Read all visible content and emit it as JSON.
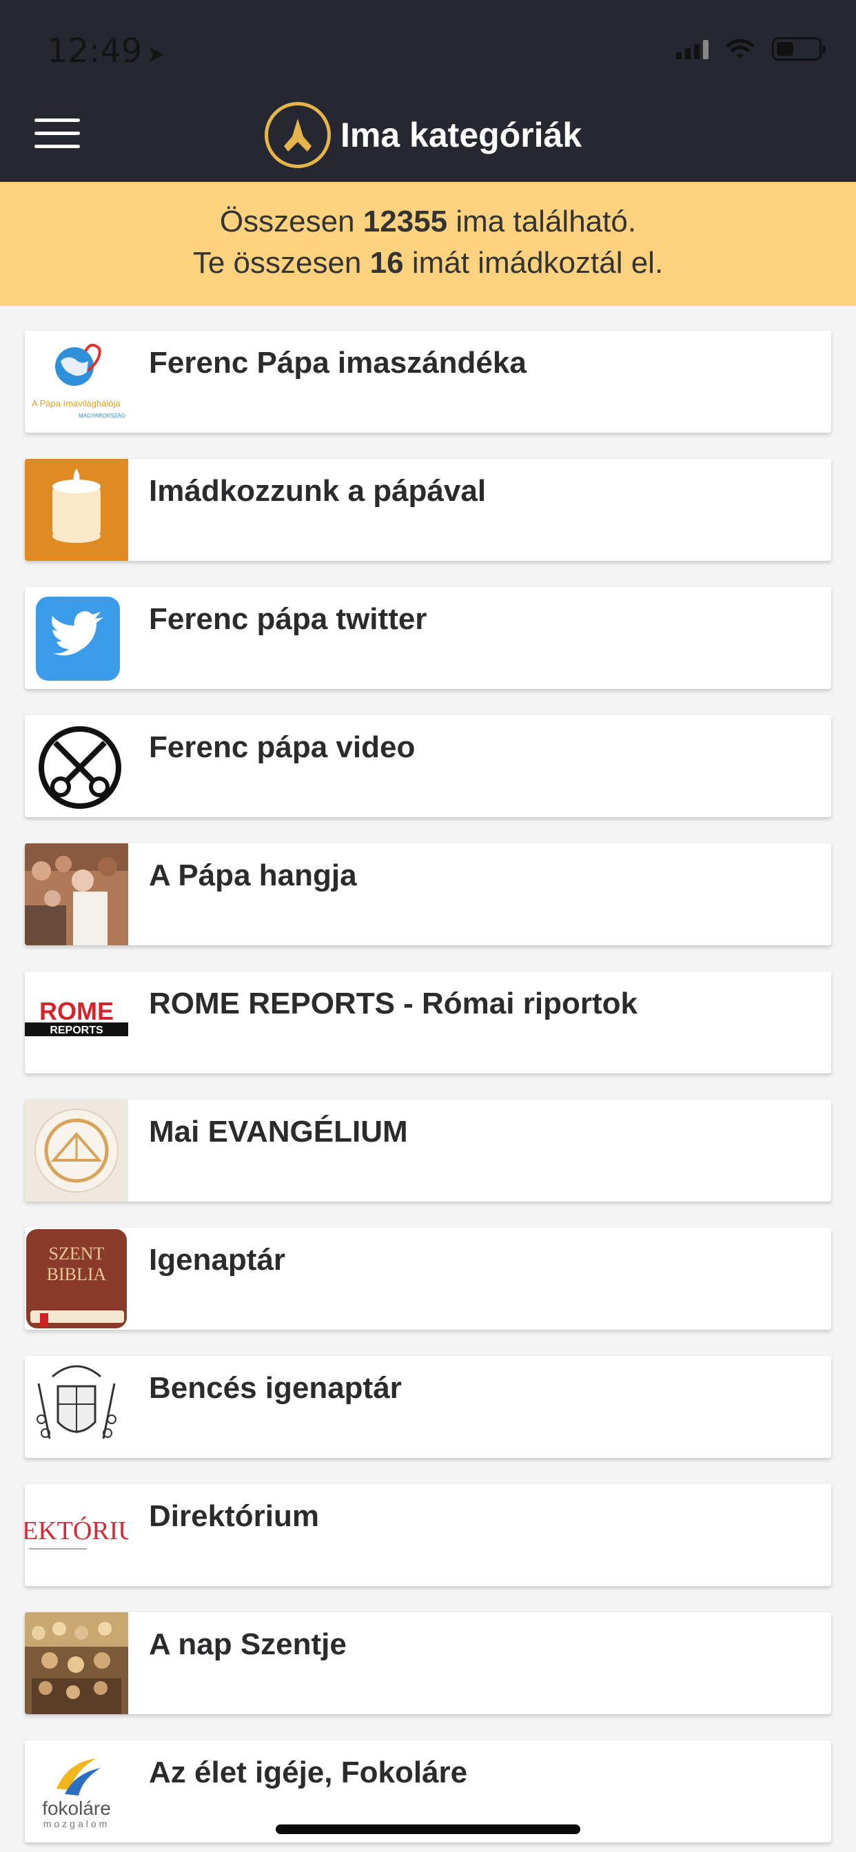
{
  "status_bar": {
    "time": "12:49"
  },
  "header": {
    "title": "Ima kategóriák"
  },
  "banner": {
    "line1_prefix": "Összesen ",
    "line1_count": "12355",
    "line1_suffix": " ima található.",
    "line2_prefix": "Te összesen ",
    "line2_count": "16",
    "line2_suffix": " imát imádkoztál el."
  },
  "categories": [
    {
      "label": "Ferenc Pápa imaszándéka",
      "thumb_text": "A Pápa Imavilághálója",
      "thumb_subtext": "MAGYARORSZÁG"
    },
    {
      "label": "Imádkozzunk a pápával"
    },
    {
      "label": "Ferenc pápa twitter"
    },
    {
      "label": "Ferenc pápa video"
    },
    {
      "label": "A Pápa hangja"
    },
    {
      "label": "ROME REPORTS - Római riportok",
      "thumb_text": "ROME",
      "thumb_subtext": "REPORTS"
    },
    {
      "label": "Mai EVANGÉLIUM"
    },
    {
      "label": "Igenaptár",
      "thumb_text": "SZENT",
      "thumb_subtext": "BIBLIA"
    },
    {
      "label": "Bencés igenaptár"
    },
    {
      "label": "Direktórium",
      "thumb_text": "EKTÓRIU"
    },
    {
      "label": "A nap Szentje"
    },
    {
      "label": "Az élet igéje, Fokoláre",
      "thumb_text": "fokoláre",
      "thumb_subtext": "mozgalom"
    }
  ],
  "colors": {
    "header_bg": "#252830",
    "banner_bg": "#fdd27f",
    "accent_gold": "#e5b54c"
  }
}
